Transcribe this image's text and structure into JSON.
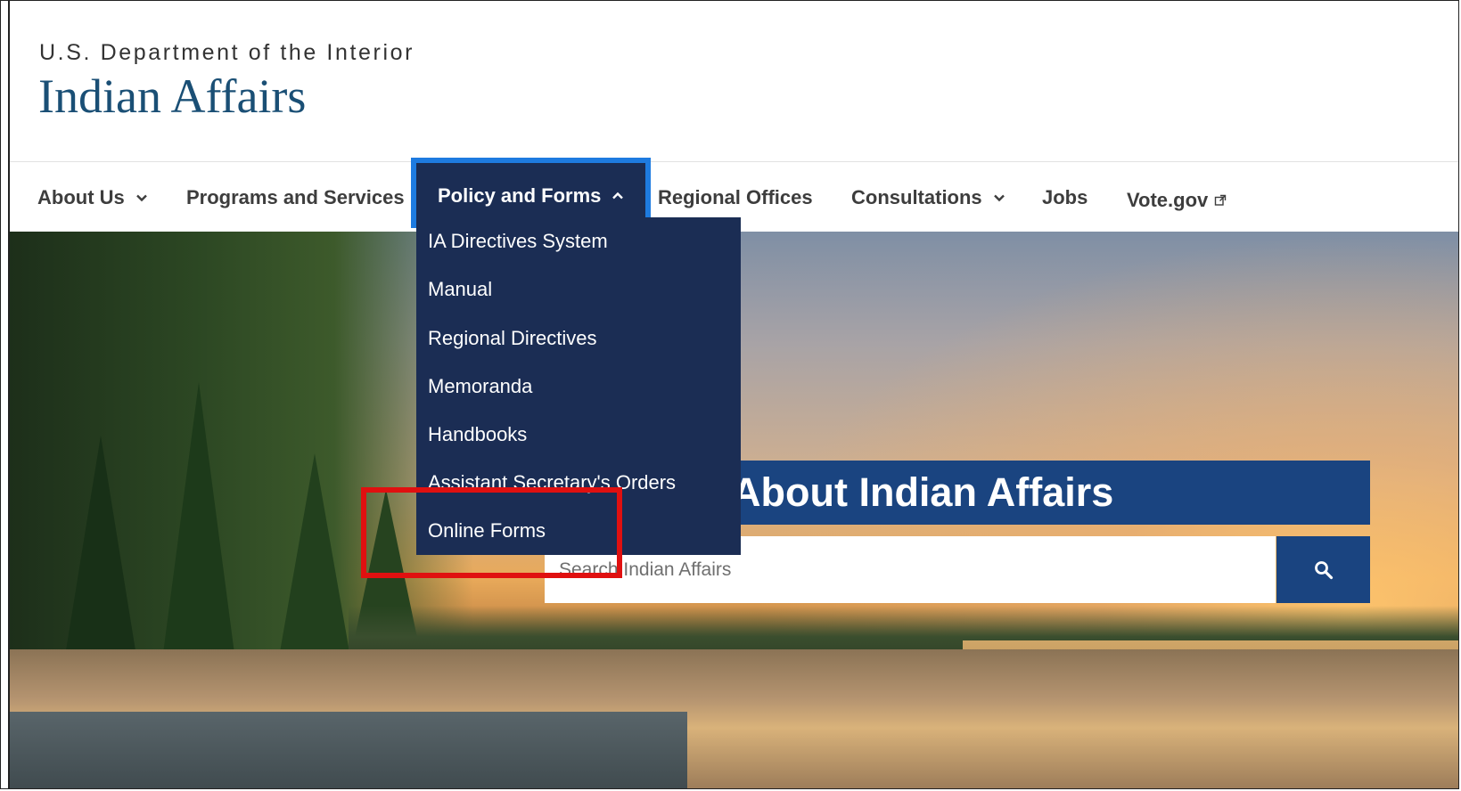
{
  "header": {
    "agency": "U.S. Department of the Interior",
    "site_title": "Indian Affairs"
  },
  "nav": {
    "items": [
      {
        "label": "About Us",
        "has_chevron": true,
        "chevron": "chevron-down-icon"
      },
      {
        "label": "Programs and Services",
        "has_chevron": false
      },
      {
        "label": "Policy and Forms",
        "has_chevron": true,
        "chevron": "chevron-up-icon",
        "active": true
      },
      {
        "label": "Regional Offices",
        "has_chevron": false
      },
      {
        "label": "Consultations",
        "has_chevron": true,
        "chevron": "chevron-down-icon"
      },
      {
        "label": "Jobs",
        "has_chevron": false
      },
      {
        "label": "Vote.gov",
        "has_chevron": false,
        "external": true,
        "icon": "external-link-icon"
      }
    ]
  },
  "dropdown": {
    "items": [
      "IA Directives System",
      "Manual",
      "Regional Directives",
      "Memoranda",
      "Handbooks",
      "Assistant Secretary's Orders",
      "Online Forms"
    ]
  },
  "hero": {
    "title": "About Indian Affairs",
    "search_placeholder": "Search Indian Affairs",
    "search_icon": "search-icon"
  },
  "colors": {
    "brand_title": "#1a4f75",
    "nav_active_bg": "#1b2d54",
    "nav_active_border": "#1e7be0",
    "hero_banner": "#1a4480",
    "highlight": "#e01010"
  }
}
